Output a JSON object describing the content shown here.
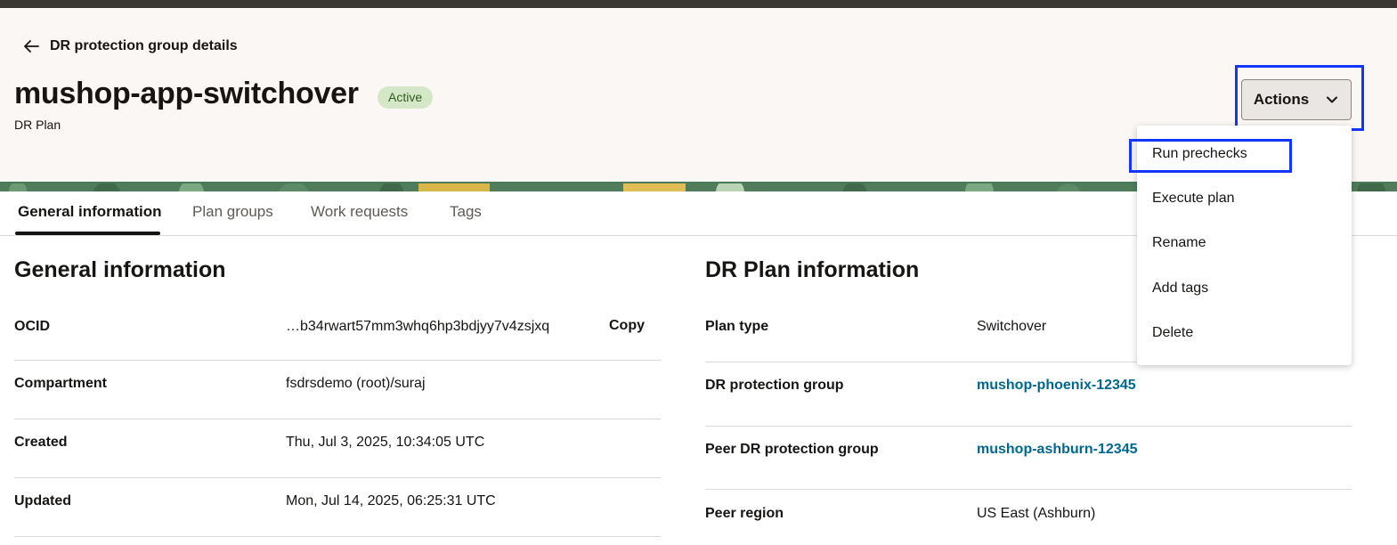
{
  "header": {
    "back_label": "DR protection group details",
    "title": "mushop-app-switchover",
    "status": "Active",
    "subtitle": "DR Plan",
    "actions_label": "Actions"
  },
  "actions_menu": {
    "items": [
      "Run prechecks",
      "Execute plan",
      "Rename",
      "Add tags",
      "Delete"
    ],
    "highlighted": "Run prechecks"
  },
  "tabs": [
    "General information",
    "Plan groups",
    "Work requests",
    "Tags"
  ],
  "active_tab": "General information",
  "general_info": {
    "title": "General information",
    "copy_label": "Copy",
    "rows": [
      {
        "label": "OCID",
        "value": "…b34rwart57mm3whq6hp3bdjyy7v4zsjxq"
      },
      {
        "label": "Compartment",
        "value": "fsdrsdemo (root)/suraj"
      },
      {
        "label": "Created",
        "value": "Thu, Jul 3, 2025, 10:34:05 UTC"
      },
      {
        "label": "Updated",
        "value": "Mon, Jul 14, 2025, 06:25:31 UTC"
      }
    ]
  },
  "dr_plan_info": {
    "title": "DR Plan information",
    "rows": [
      {
        "label": "Plan type",
        "value": "Switchover"
      },
      {
        "label": "DR protection group",
        "value": "mushop-phoenix-12345"
      },
      {
        "label": "Peer DR protection group",
        "value": "mushop-ashburn-12345"
      },
      {
        "label": "Peer region",
        "value": "US East (Ashburn)"
      }
    ]
  },
  "colors": {
    "link": "#00688c",
    "highlight": "#1236ff",
    "status_bg": "#d4e8c7"
  }
}
